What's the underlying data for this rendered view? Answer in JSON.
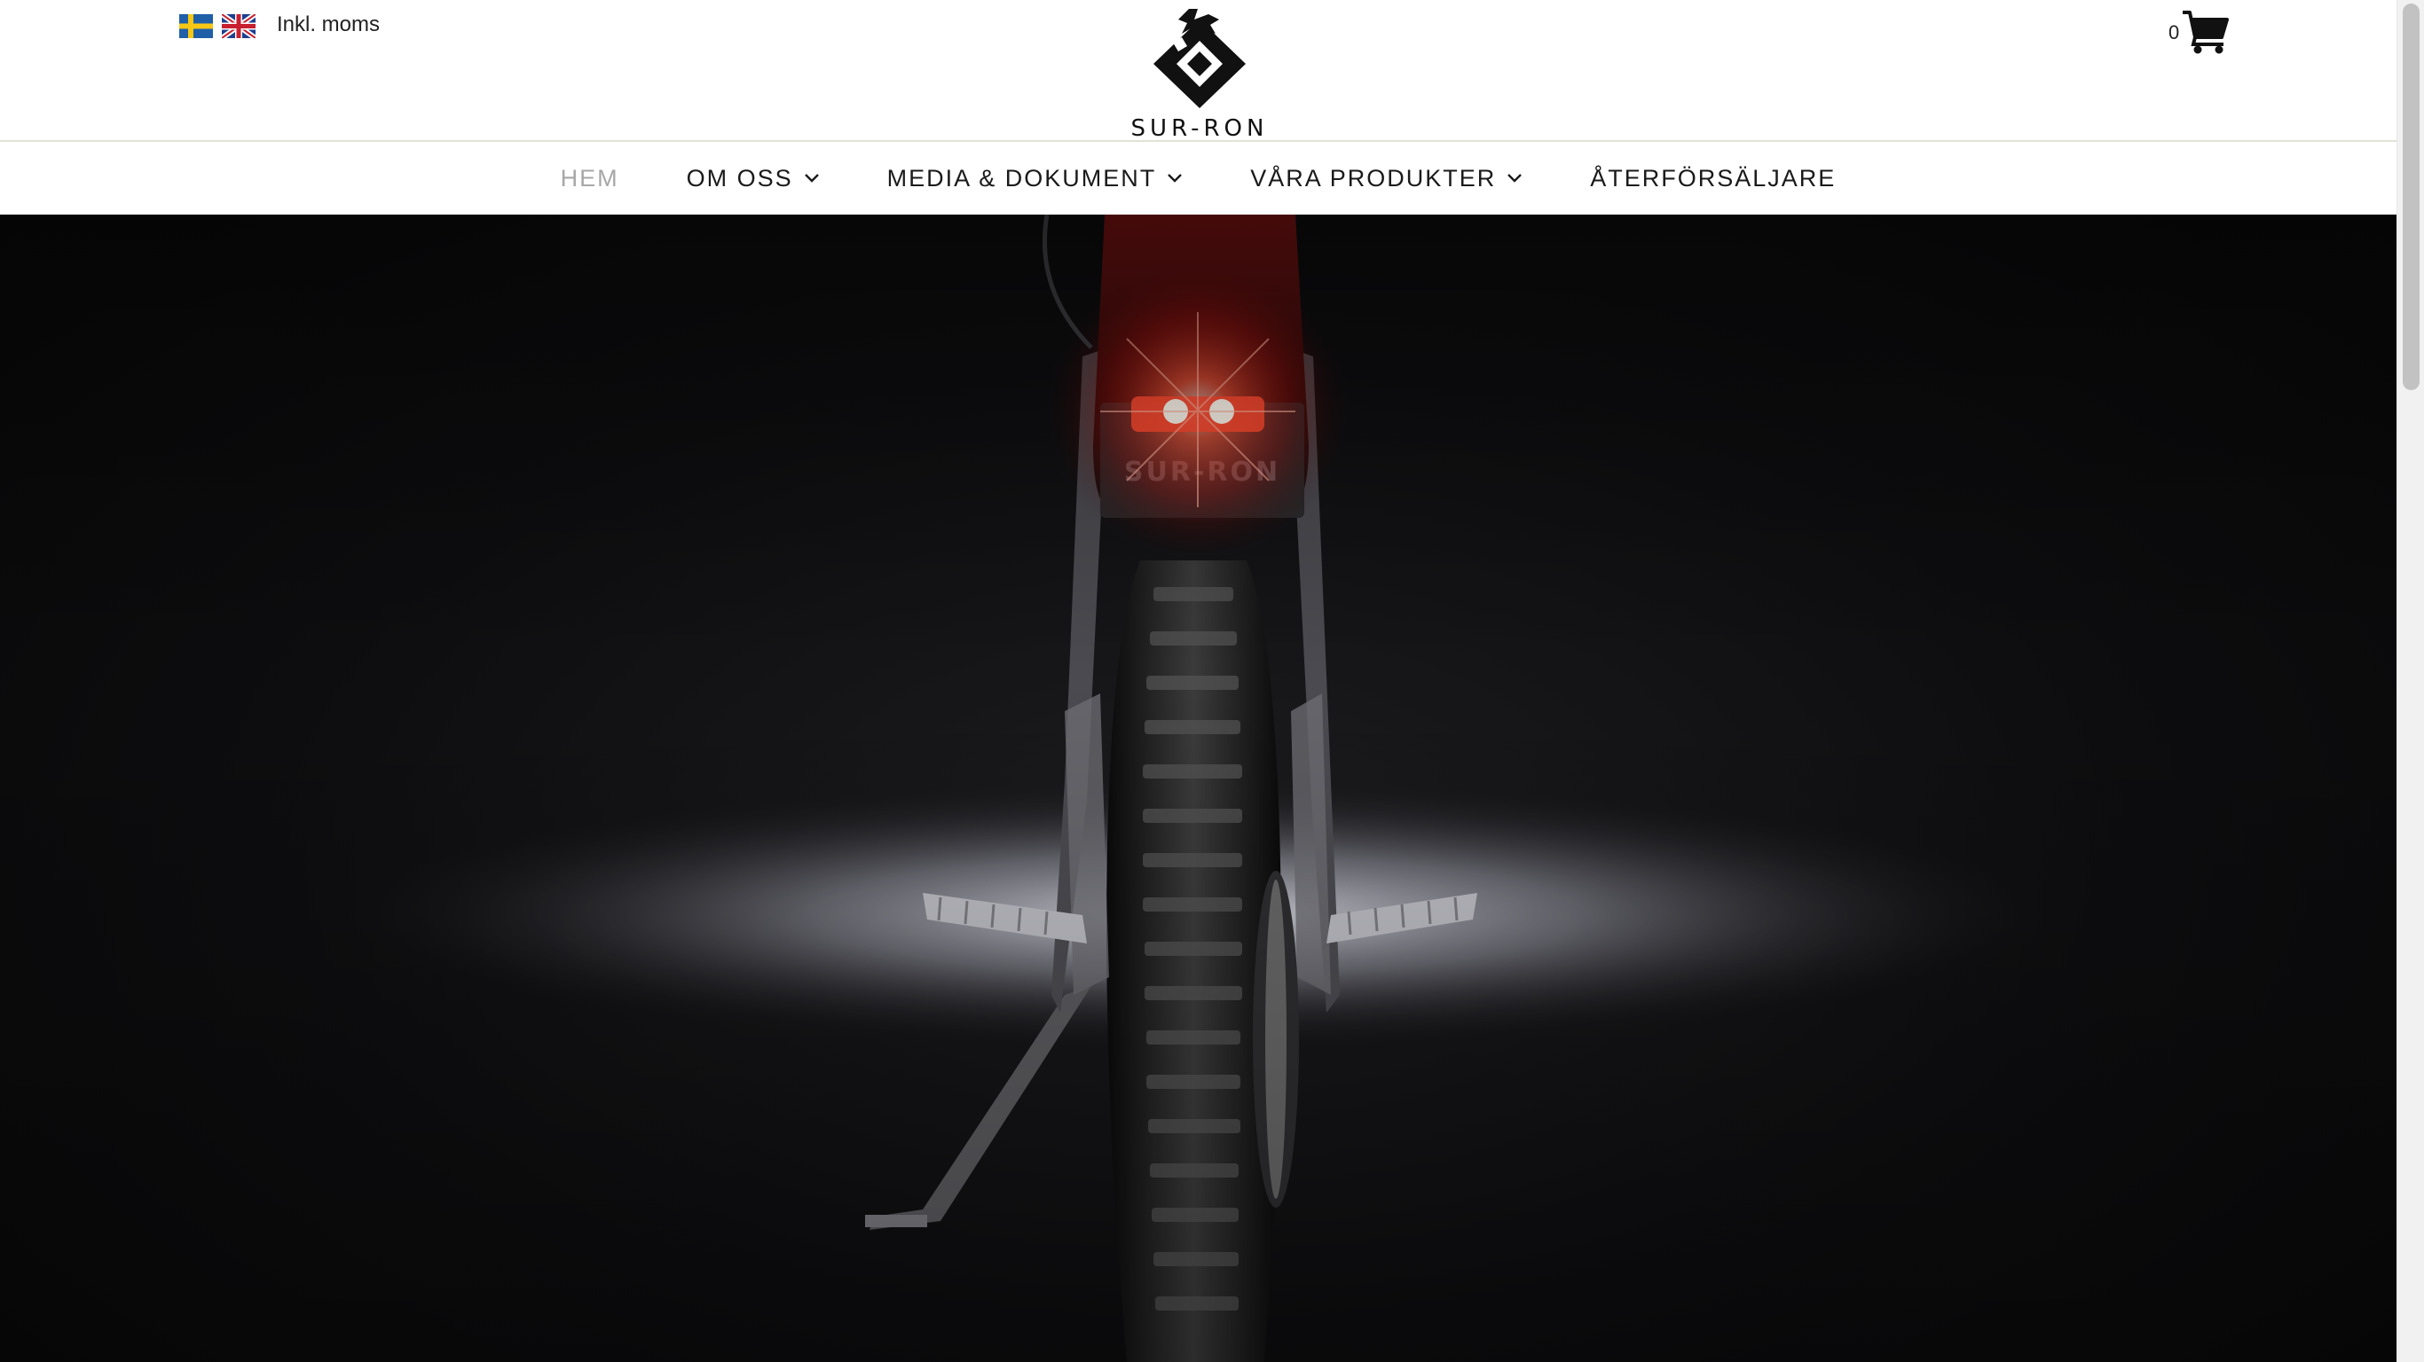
{
  "header": {
    "flags": [
      {
        "icon": "flag-sweden-icon",
        "lang": "sv"
      },
      {
        "icon": "flag-uk-icon",
        "lang": "en"
      }
    ],
    "vat_label": "Inkl. moms",
    "logo_text": "SUR-RON",
    "cart": {
      "count": "0",
      "icon": "shopping-cart-icon"
    }
  },
  "nav": {
    "items": [
      {
        "label": "HEM",
        "active": true,
        "dropdown": false
      },
      {
        "label": "OM OSS",
        "active": false,
        "dropdown": true
      },
      {
        "label": "MEDIA & DOKUMENT",
        "active": false,
        "dropdown": true
      },
      {
        "label": "VÅRA PRODUKTER",
        "active": false,
        "dropdown": true
      },
      {
        "label": "ÅTERFÖRSÄLJARE",
        "active": false,
        "dropdown": false
      }
    ]
  },
  "hero": {
    "image": "rear view of a Sur-Ron electric motorbike with red tail light on dark background",
    "plate_text": "SUR-RON"
  },
  "colors": {
    "nav_active": "#a7a7a7",
    "nav_text": "#1a1a1a",
    "tail_light": "#ff3b2a",
    "hero_bg": "#0d0d0f"
  }
}
